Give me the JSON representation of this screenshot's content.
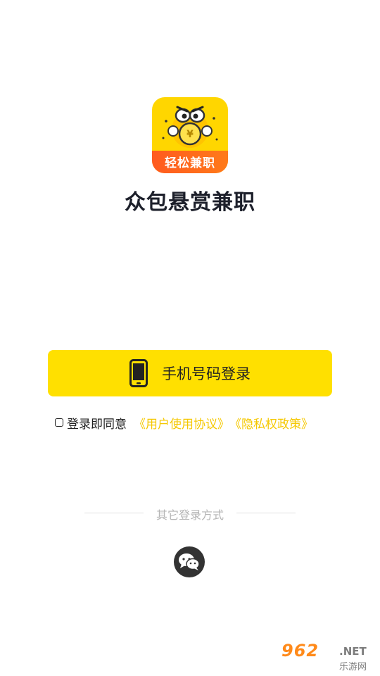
{
  "app": {
    "icon_caption": "轻松兼职",
    "name": "众包悬赏兼职",
    "colors": {
      "accent": "#ffe000",
      "link": "#f5c800",
      "logo_band": "#ff5a1f"
    }
  },
  "login": {
    "phone_button_label": "手机号码登录",
    "phone_icon": "mobile-phone-icon"
  },
  "agreement": {
    "checked": false,
    "prefix": "登录即同意",
    "user_agreement": "《用户使用协议》",
    "privacy_policy": "《隐私权政策》"
  },
  "other_login": {
    "title": "其它登录方式",
    "options": [
      {
        "icon": "wechat-icon"
      }
    ]
  },
  "watermark": {
    "number": "962",
    "domain": ".NET",
    "site_name": "乐游网"
  }
}
